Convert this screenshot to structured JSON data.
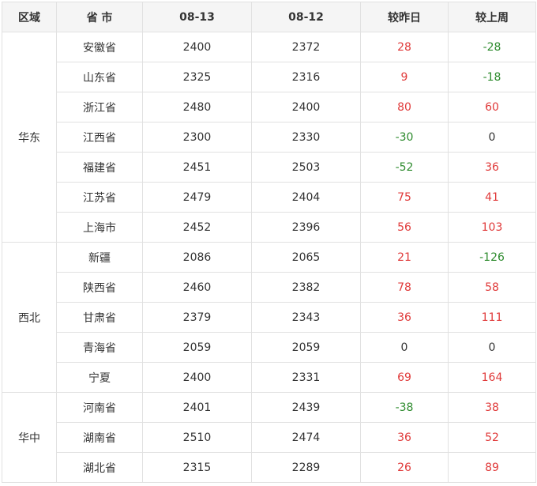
{
  "header": {
    "region": "区域",
    "province": "省 市",
    "date_current": "08-13",
    "date_previous": "08-12",
    "vs_yesterday": "较昨日",
    "vs_last_week": "较上周"
  },
  "colors": {
    "up": "#e03a3a",
    "down": "#2e8b2e",
    "flat": "#333333"
  },
  "regions": [
    {
      "name": "华东",
      "rows": [
        {
          "province": "安徽省",
          "today": "2400",
          "yesterday": "2372",
          "day_change": "28",
          "week_change": "-28"
        },
        {
          "province": "山东省",
          "today": "2325",
          "yesterday": "2316",
          "day_change": "9",
          "week_change": "-18"
        },
        {
          "province": "浙江省",
          "today": "2480",
          "yesterday": "2400",
          "day_change": "80",
          "week_change": "60"
        },
        {
          "province": "江西省",
          "today": "2300",
          "yesterday": "2330",
          "day_change": "-30",
          "week_change": "0"
        },
        {
          "province": "福建省",
          "today": "2451",
          "yesterday": "2503",
          "day_change": "-52",
          "week_change": "36"
        },
        {
          "province": "江苏省",
          "today": "2479",
          "yesterday": "2404",
          "day_change": "75",
          "week_change": "41"
        },
        {
          "province": "上海市",
          "today": "2452",
          "yesterday": "2396",
          "day_change": "56",
          "week_change": "103"
        }
      ]
    },
    {
      "name": "西北",
      "rows": [
        {
          "province": "新疆",
          "today": "2086",
          "yesterday": "2065",
          "day_change": "21",
          "week_change": "-126"
        },
        {
          "province": "陕西省",
          "today": "2460",
          "yesterday": "2382",
          "day_change": "78",
          "week_change": "58"
        },
        {
          "province": "甘肃省",
          "today": "2379",
          "yesterday": "2343",
          "day_change": "36",
          "week_change": "111"
        },
        {
          "province": "青海省",
          "today": "2059",
          "yesterday": "2059",
          "day_change": "0",
          "week_change": "0"
        },
        {
          "province": "宁夏",
          "today": "2400",
          "yesterday": "2331",
          "day_change": "69",
          "week_change": "164"
        }
      ]
    },
    {
      "name": "华中",
      "rows": [
        {
          "province": "河南省",
          "today": "2401",
          "yesterday": "2439",
          "day_change": "-38",
          "week_change": "38"
        },
        {
          "province": "湖南省",
          "today": "2510",
          "yesterday": "2474",
          "day_change": "36",
          "week_change": "52"
        },
        {
          "province": "湖北省",
          "today": "2315",
          "yesterday": "2289",
          "day_change": "26",
          "week_change": "89"
        }
      ]
    }
  ]
}
